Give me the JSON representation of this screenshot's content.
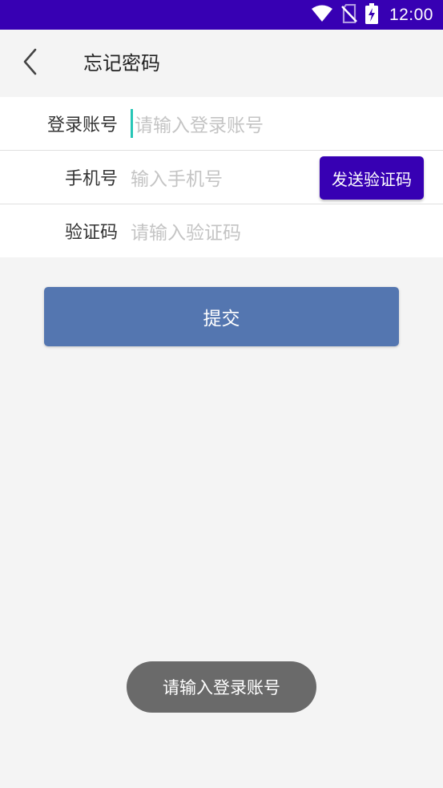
{
  "status_bar": {
    "time": "12:00",
    "background": "#3700b3",
    "icons": [
      "wifi-icon",
      "no-sim-icon",
      "battery-charging-icon"
    ]
  },
  "app_bar": {
    "back_icon": "chevron-left-icon",
    "title": "忘记密码"
  },
  "form": {
    "account": {
      "label": "登录账号",
      "placeholder": "请输入登录账号",
      "value": ""
    },
    "phone": {
      "label": "手机号",
      "placeholder": "输入手机号",
      "value": ""
    },
    "code": {
      "label": "验证码",
      "placeholder": "请输入验证码",
      "value": ""
    },
    "send_code_label": "发送验证码"
  },
  "submit_label": "提交",
  "toast": {
    "message": "请输入登录账号"
  },
  "colors": {
    "primary": "#3700b3",
    "submit": "#5476b0",
    "caret": "#26c6b6",
    "toast": "#6a6a6a"
  }
}
